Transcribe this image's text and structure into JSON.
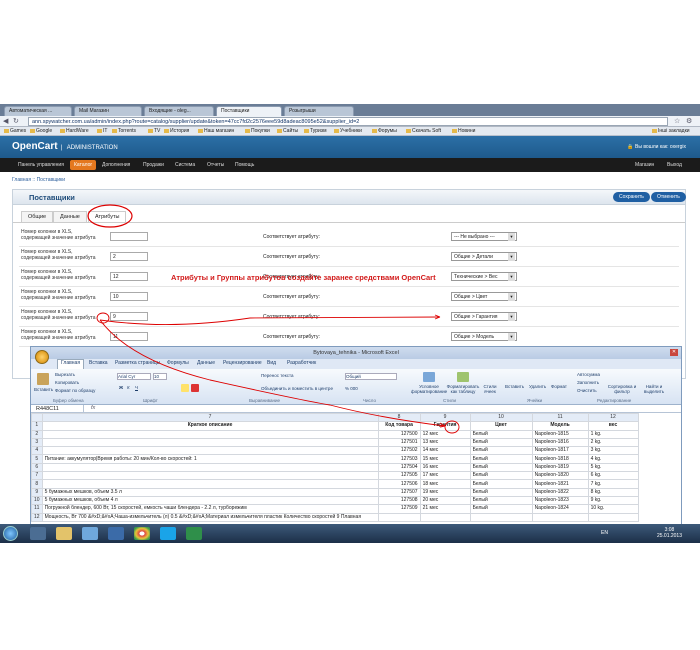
{
  "browser": {
    "tabs": [
      "Автоматическая ...",
      "Mail Магазин",
      "Входящие - oleg...",
      "Поставщики",
      "Розыгрыши"
    ],
    "url": "ann.spywatcher.com.ua/admin/index.php?route=catalog/supplier/update&token=47cc7fd2c2576eee59d8adeac8095e52&supplier_id=2",
    "bookmarks": [
      "Games",
      "Google",
      "HardWare",
      "IT",
      "Torrents",
      "TV",
      "История",
      "Наш магазин",
      "Покупки",
      "Сайты",
      "Туризм",
      "Учебники",
      "Форумы",
      "Скачать Soft",
      "Новини"
    ],
    "other_bookmarks": "Інші закладки"
  },
  "opencart": {
    "logo": "OpenCart",
    "logo_sub": "ADMINISTRATION",
    "login": "Вы вошли как: oxergix",
    "menu": [
      "Панель управления",
      "Каталог",
      "Дополнения",
      "Продажи",
      "Система",
      "Отчеты",
      "Помощь"
    ],
    "menu_right": [
      "Магазин",
      "Выход"
    ],
    "breadcrumb": "Главная :: Поставщики",
    "panel_title": "Поставщики",
    "save": "Сохранить",
    "cancel": "Отменить",
    "tabs": [
      "Общие",
      "Данные",
      "Атрибуты"
    ],
    "row_label": "Номер колонки в XLS, содержащей значение атрибута",
    "match_label": "Соответствует атрибуту:",
    "rows": [
      {
        "col": "",
        "attr": "--- Не выбрано ---"
      },
      {
        "col": "2",
        "attr": "Общие > Детали"
      },
      {
        "col": "12",
        "attr": "Технические > Вес"
      },
      {
        "col": "10",
        "attr": "Общие > Цвет"
      },
      {
        "col": "9",
        "attr": "Общие > Гарантия"
      },
      {
        "col": "11",
        "attr": "Общие > Модель"
      }
    ],
    "annotation": "Атрибуты и Группы атрибутов создайте заранее средствами OpenCart"
  },
  "excel": {
    "title": "Bytovaya_tehnika - Microsoft Excel",
    "tabs": [
      "Главная",
      "Вставка",
      "Разметка страницы",
      "Формулы",
      "Данные",
      "Рецензирование",
      "Вид",
      "Разработчик"
    ],
    "ribbon": {
      "paste": "Вставить",
      "cut": "Вырезать",
      "copy": "Копировать",
      "format_painter": "Формат по образцу",
      "font": "Arial Cyr",
      "size": "10",
      "wrap": "Перенос текста",
      "merge": "Объединить и поместить в центре",
      "number_format": "Общий",
      "conditional": "Условное форматирование",
      "as_table": "Форматировать как таблицу",
      "styles": "Стили ячеек",
      "insert": "Вставить",
      "delete": "Удалить",
      "format": "Формат",
      "autosum": "Автосумма",
      "fill": "Заполнить",
      "clear": "Очистить",
      "sort": "Сортировка и фильтр",
      "find": "Найти и выделить",
      "groups": [
        "Буфер обмена",
        "Шрифт",
        "Выравнивание",
        "Число",
        "Стили",
        "Ячейки",
        "Редактирование"
      ]
    },
    "name_box": "R448C11",
    "col_numbers": [
      "7",
      "8",
      "9",
      "10",
      "11",
      "12"
    ],
    "header": [
      "Краткое описание",
      "Код товара",
      "Гарантия",
      "Цвет",
      "Модель",
      "вес"
    ],
    "rows": [
      [
        "",
        "127500",
        "12 мес",
        "Белый",
        "Napoleon-1815",
        "1 kg."
      ],
      [
        "",
        "127501",
        "13 мес",
        "Белый",
        "Napoleon-1816",
        "2 kg."
      ],
      [
        "",
        "127502",
        "14 мес",
        "Белый",
        "Napoleon-1817",
        "3 kg."
      ],
      [
        "Питание: аккумулятор|Время работы: 20 мин/Кол-во скоростей: 1",
        "127503",
        "15 мес",
        "Белый",
        "Napoleon-1818",
        "4 kg."
      ],
      [
        "",
        "127504",
        "16 мес",
        "Белый",
        "Napoleon-1819",
        "5 kg."
      ],
      [
        "",
        "127505",
        "17 мес",
        "Белый",
        "Napoleon-1820",
        "6 kg."
      ],
      [
        "",
        "127506",
        "18 мес",
        "Белый",
        "Napoleon-1821",
        "7 kg."
      ],
      [
        "5 бумажных мешков, объем 3.5 л",
        "127507",
        "19 мес",
        "Белый",
        "Napoleon-1822",
        "8 kg."
      ],
      [
        "5 бумажных мешков, объем 4 л",
        "127508",
        "20 мес",
        "Белый",
        "Napoleon-1823",
        "9 kg."
      ],
      [
        "Погружной блендер, 600 Вт, 15 скоростей, емкость чаши блендера - 2.2 л, турборежим",
        "127509",
        "21 мес",
        "Белый",
        "Napoleon-1824",
        "10 kg."
      ],
      [
        "Мощность, Вт 700 &#xD;&#xA;Чаша-измельчитель (л) 0.5 &#xD;&#xA;Материал измельчителя пластик Количество скоростей 9 Плавная",
        "",
        "",
        "",
        "",
        ""
      ]
    ]
  },
  "taskbar": {
    "lang": "EN",
    "time": "3:08",
    "date": "25.01.2013"
  }
}
